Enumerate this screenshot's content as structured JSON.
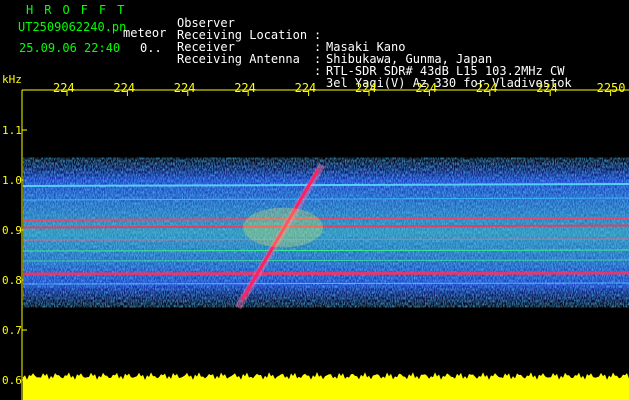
{
  "header": {
    "logo": "HROFFT",
    "filename": "UT2509062240.pn",
    "file_type": "meteor",
    "datetime": "25.09.06 22:40",
    "datetime_suffix": "0..",
    "fields": [
      {
        "label": "Observer",
        "sep": ":",
        "value": "Masaki Kano"
      },
      {
        "label": "Receiving Location",
        "sep": ":",
        "value": "Shibukawa, Gunma, Japan"
      },
      {
        "label": "Receiver",
        "sep": ":",
        "value": "RTL-SDR SDR# 43dB L15 103.2MHz CW"
      },
      {
        "label": "Receiving Antenna",
        "sep": ":",
        "value": "3el Yagi(V) Az 330 for Vladivostok"
      }
    ]
  },
  "chart_data": {
    "type": "heatmap",
    "ylabel": "kHz",
    "x_ticks": [
      "224",
      "224",
      "224",
      "224",
      "224",
      "224",
      "224",
      "224",
      "224",
      "2250"
    ],
    "y_ticks": [
      "1.1",
      "1.0",
      "0.9",
      "0.8",
      "0.7",
      "0.6"
    ],
    "ylim": [
      0.6,
      1.1
    ],
    "colors": {
      "background": "#000000",
      "axis": "#ffff00",
      "noise": "#1a3cff",
      "signal": "#ff2060"
    }
  }
}
